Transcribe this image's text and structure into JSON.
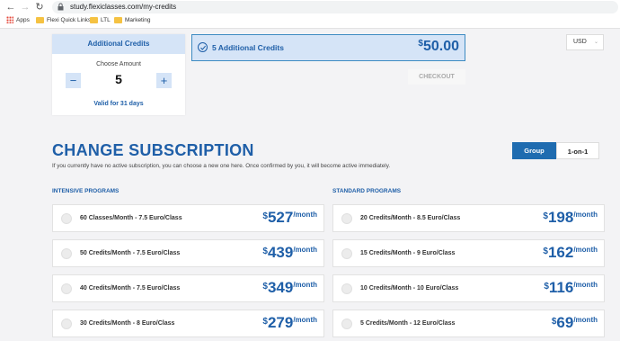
{
  "browser": {
    "url": "study.flexiclasses.com/my-credits",
    "bookmarks": [
      "Apps",
      "Flexi Quick Links",
      "LTL",
      "Marketing"
    ]
  },
  "credits": {
    "title": "Additional Credits",
    "choose_label": "Choose Amount",
    "amount": "5",
    "minus": "−",
    "plus": "+",
    "valid": "Valid for 31 days"
  },
  "package": {
    "label": "5 Additional Credits",
    "currency_symbol": "$",
    "price": "50.00"
  },
  "checkout_label": "CHECKOUT",
  "currency_select": {
    "value": "USD"
  },
  "subscription": {
    "title": "CHANGE SUBSCRIPTION",
    "description": "If you currently have no active subscription, you can choose a new one here. Once confirmed by you, it will become active immediately.",
    "toggle": {
      "group": "Group",
      "one_on_one": "1-on-1"
    },
    "intensive": {
      "heading": "INTENSIVE PROGRAMS",
      "plans": [
        {
          "label": "60 Classes/Month - 7.5 Euro/Class",
          "amount": "527",
          "per": "/month"
        },
        {
          "label": "50 Credits/Month - 7.5 Euro/Class",
          "amount": "439",
          "per": "/month"
        },
        {
          "label": "40 Credits/Month - 7.5 Euro/Class",
          "amount": "349",
          "per": "/month"
        },
        {
          "label": "30 Credits/Month - 8 Euro/Class",
          "amount": "279",
          "per": "/month"
        }
      ]
    },
    "standard": {
      "heading": "STANDARD PROGRAMS",
      "plans": [
        {
          "label": "20 Credits/Month - 8.5 Euro/Class",
          "amount": "198",
          "per": "/month"
        },
        {
          "label": "15 Credits/Month - 9 Euro/Class",
          "amount": "162",
          "per": "/month"
        },
        {
          "label": "10 Credits/Month - 10 Euro/Class",
          "amount": "116",
          "per": "/month"
        },
        {
          "label": "5 Credits/Month - 12 Euro/Class",
          "amount": "69",
          "per": "/month"
        }
      ]
    },
    "currency_symbol": "$"
  },
  "colors": {
    "accent": "#1f5fa8",
    "accent_light": "#d5e4f7",
    "background": "#f3f3f5"
  }
}
